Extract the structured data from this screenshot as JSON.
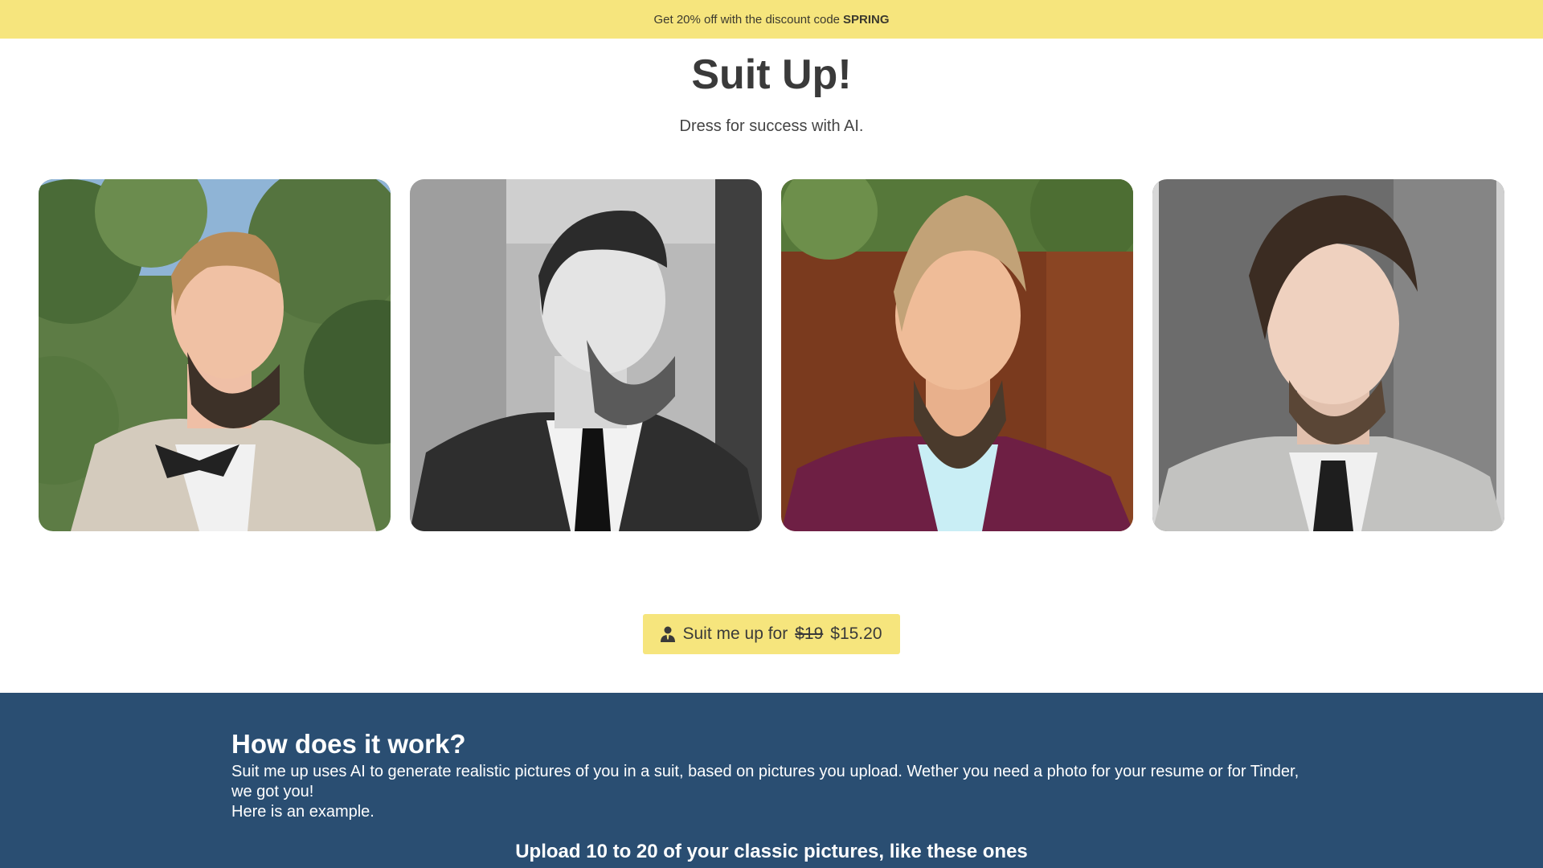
{
  "promo": {
    "text": "Get 20% off with the discount code",
    "code": "SPRING",
    "background": "#f6e57d"
  },
  "hero": {
    "title": "Suit Up!",
    "subtitle": "Dress for success with AI."
  },
  "gallery": {
    "photos": [
      {
        "alt": "man-beard-beige-suit-bowtie"
      },
      {
        "alt": "man-beard-black-white-suit"
      },
      {
        "alt": "man-beard-purple-suit"
      },
      {
        "alt": "man-beard-grey-suit"
      }
    ]
  },
  "cta": {
    "icon": "person-suit-icon",
    "label": "Suit me up for",
    "old_price": "$19",
    "new_price": "$15.20",
    "background": "#f6e57d"
  },
  "how": {
    "title": "How does it work?",
    "line1": "Suit me up uses AI to generate realistic pictures of you in a suit, based on pictures you upload. Wether you need a photo for your resume or for Tinder, we got you!",
    "line2": "Here is an example.",
    "upload_heading": "Upload 10 to 20 of your classic pictures, like these ones",
    "background": "#2a4e72"
  }
}
